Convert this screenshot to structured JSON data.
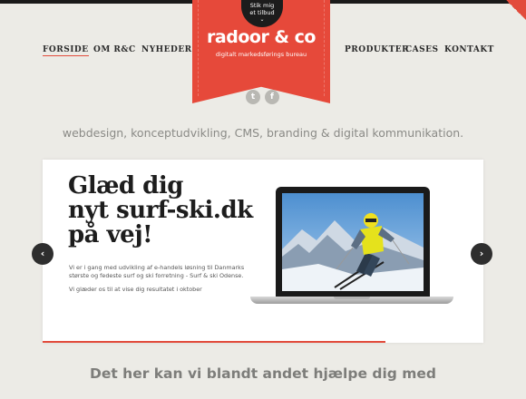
{
  "nav": {
    "left": [
      {
        "label": "FORSIDE",
        "active": true
      },
      {
        "label": "OM R&C",
        "active": false
      },
      {
        "label": "NYHEDER",
        "active": false
      }
    ],
    "right": [
      {
        "label": "PRODUKTER",
        "active": false
      },
      {
        "label": "CASES",
        "active": false
      },
      {
        "label": "KONTAKT",
        "active": false
      }
    ]
  },
  "brand": {
    "offer_line1": "Stik mig",
    "offer_line2": "et tilbud",
    "logo": "radoor & co",
    "tagline": "digitalt markedsførings bureau",
    "social": [
      {
        "icon": "twitter-icon",
        "glyph": "t"
      },
      {
        "icon": "facebook-icon",
        "glyph": "f"
      }
    ]
  },
  "services_line": "webdesign, konceptudvikling, CMS, branding & digital kommunikation.",
  "slider": {
    "title_line1": "Glæd dig",
    "title_line2": "nyt surf-ski.dk",
    "title_line3": "på vej!",
    "paragraph1": "Vi er i gang med udvikling af e-handels løsning til Danmarks største og fedeste surf og ski forretning - Surf & ski Odense.",
    "paragraph2": "Vi glæder os til at vise dig resultatet i oktober",
    "prev_glyph": "‹",
    "next_glyph": "›"
  },
  "help_heading": "Det her kan vi blandt andet hjælpe dig med",
  "colors": {
    "accent": "#e6493a",
    "background": "#ecebe6",
    "text_dark": "#1d1d1d"
  }
}
